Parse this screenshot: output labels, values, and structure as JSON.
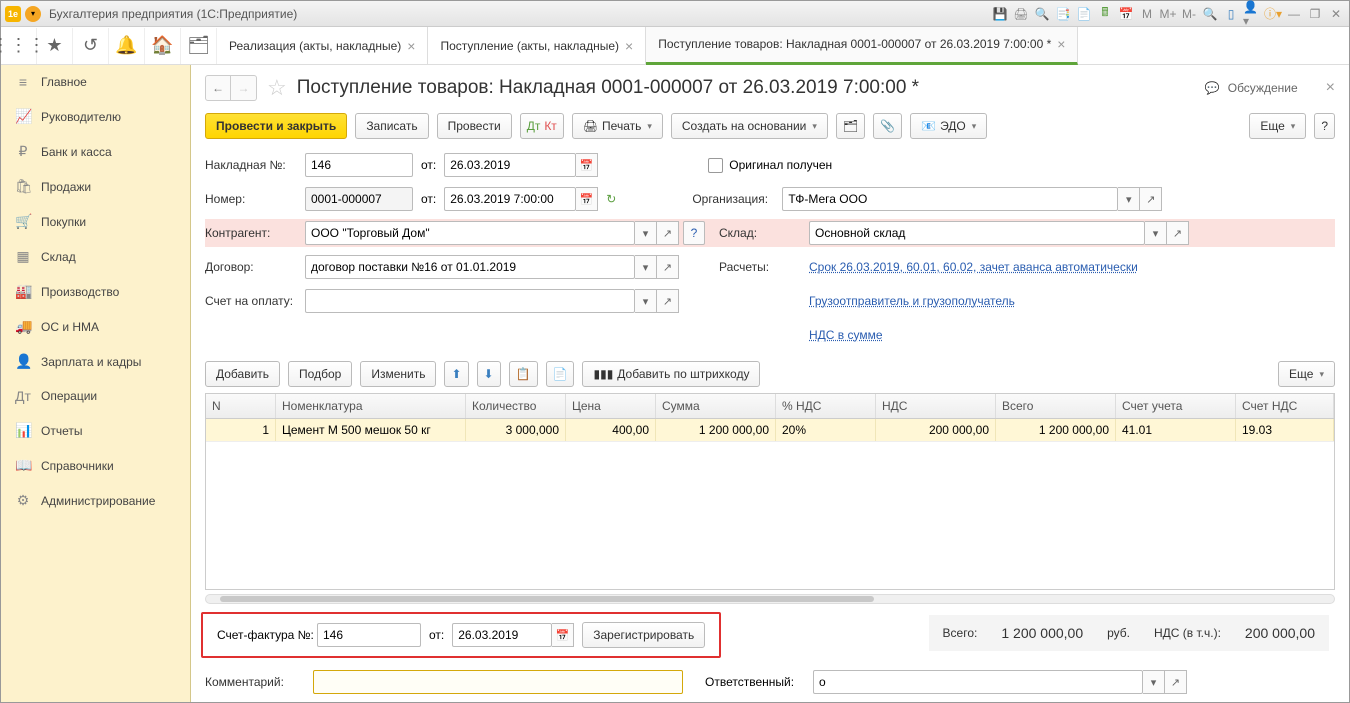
{
  "window": {
    "title": "Бухгалтерия предприятия  (1С:Предприятие)"
  },
  "tabs": [
    {
      "label": "Реализация (акты, накладные)"
    },
    {
      "label": "Поступление (акты, накладные)"
    },
    {
      "label": "Поступление товаров: Накладная 0001-000007 от 26.03.2019 7:00:00 *"
    }
  ],
  "sidebar": {
    "items": [
      {
        "icon": "≡",
        "label": "Главное"
      },
      {
        "icon": "📈",
        "label": "Руководителю"
      },
      {
        "icon": "₽",
        "label": "Банк и касса"
      },
      {
        "icon": "🛍",
        "label": "Продажи"
      },
      {
        "icon": "🛒",
        "label": "Покупки"
      },
      {
        "icon": "▦",
        "label": "Склад"
      },
      {
        "icon": "🏭",
        "label": "Производство"
      },
      {
        "icon": "🚚",
        "label": "ОС и НМА"
      },
      {
        "icon": "👤",
        "label": "Зарплата и кадры"
      },
      {
        "icon": "Дт",
        "label": "Операции"
      },
      {
        "icon": "📊",
        "label": "Отчеты"
      },
      {
        "icon": "📖",
        "label": "Справочники"
      },
      {
        "icon": "⚙",
        "label": "Администрирование"
      }
    ]
  },
  "doc": {
    "title": "Поступление товаров: Накладная 0001-000007 от 26.03.2019 7:00:00 *",
    "discuss": "Обсуждение"
  },
  "actions": {
    "post_close": "Провести и закрыть",
    "save": "Записать",
    "post": "Провести",
    "print": "Печать",
    "create_based": "Создать на основании",
    "edo": "ЭДО",
    "more": "Еще"
  },
  "form": {
    "invoice_no_lbl": "Накладная №:",
    "invoice_no": "146",
    "from": "от:",
    "invoice_date": "26.03.2019",
    "number_lbl": "Номер:",
    "number": "0001-000007",
    "number_date": "26.03.2019 7:00:00",
    "original_lbl": "Оригинал получен",
    "org_lbl": "Организация:",
    "org": "ТФ-Мега ООО",
    "counterparty_lbl": "Контрагент:",
    "counterparty": "ООО \"Торговый Дом\"",
    "warehouse_lbl": "Склад:",
    "warehouse": "Основной склад",
    "contract_lbl": "Договор:",
    "contract": "договор поставки №16 от 01.01.2019",
    "calc_lbl": "Расчеты:",
    "calc_link": "Срок 26.03.2019, 60.01, 60.02, зачет аванса автоматически",
    "bill_lbl": "Счет на оплату:",
    "shipper_link": "Грузоотправитель и грузополучатель",
    "vat_link": "НДС в сумме"
  },
  "table_toolbar": {
    "add": "Добавить",
    "pick": "Подбор",
    "edit": "Изменить",
    "add_barcode": "Добавить по штрихкоду",
    "more": "Еще"
  },
  "grid": {
    "headers": [
      "N",
      "Номенклатура",
      "Количество",
      "Цена",
      "Сумма",
      "% НДС",
      "НДС",
      "Всего",
      "Счет учета",
      "Счет НДС"
    ],
    "rows": [
      {
        "n": "1",
        "name": "Цемент М 500 мешок 50 кг",
        "qty": "3 000,000",
        "price": "400,00",
        "sum": "1 200 000,00",
        "vat_pct": "20%",
        "vat": "200 000,00",
        "total": "1 200 000,00",
        "acct": "41.01",
        "vat_acct": "19.03"
      }
    ]
  },
  "invoice": {
    "lbl": "Счет-фактура №:",
    "no": "146",
    "from": "от:",
    "date": "26.03.2019",
    "register": "Зарегистрировать"
  },
  "totals": {
    "total_lbl": "Всего:",
    "total": "1 200 000,00",
    "currency": "руб.",
    "vat_lbl": "НДС (в т.ч.):",
    "vat": "200 000,00"
  },
  "footer": {
    "comment_lbl": "Комментарий:",
    "resp_lbl": "Ответственный:",
    "resp": "о"
  }
}
